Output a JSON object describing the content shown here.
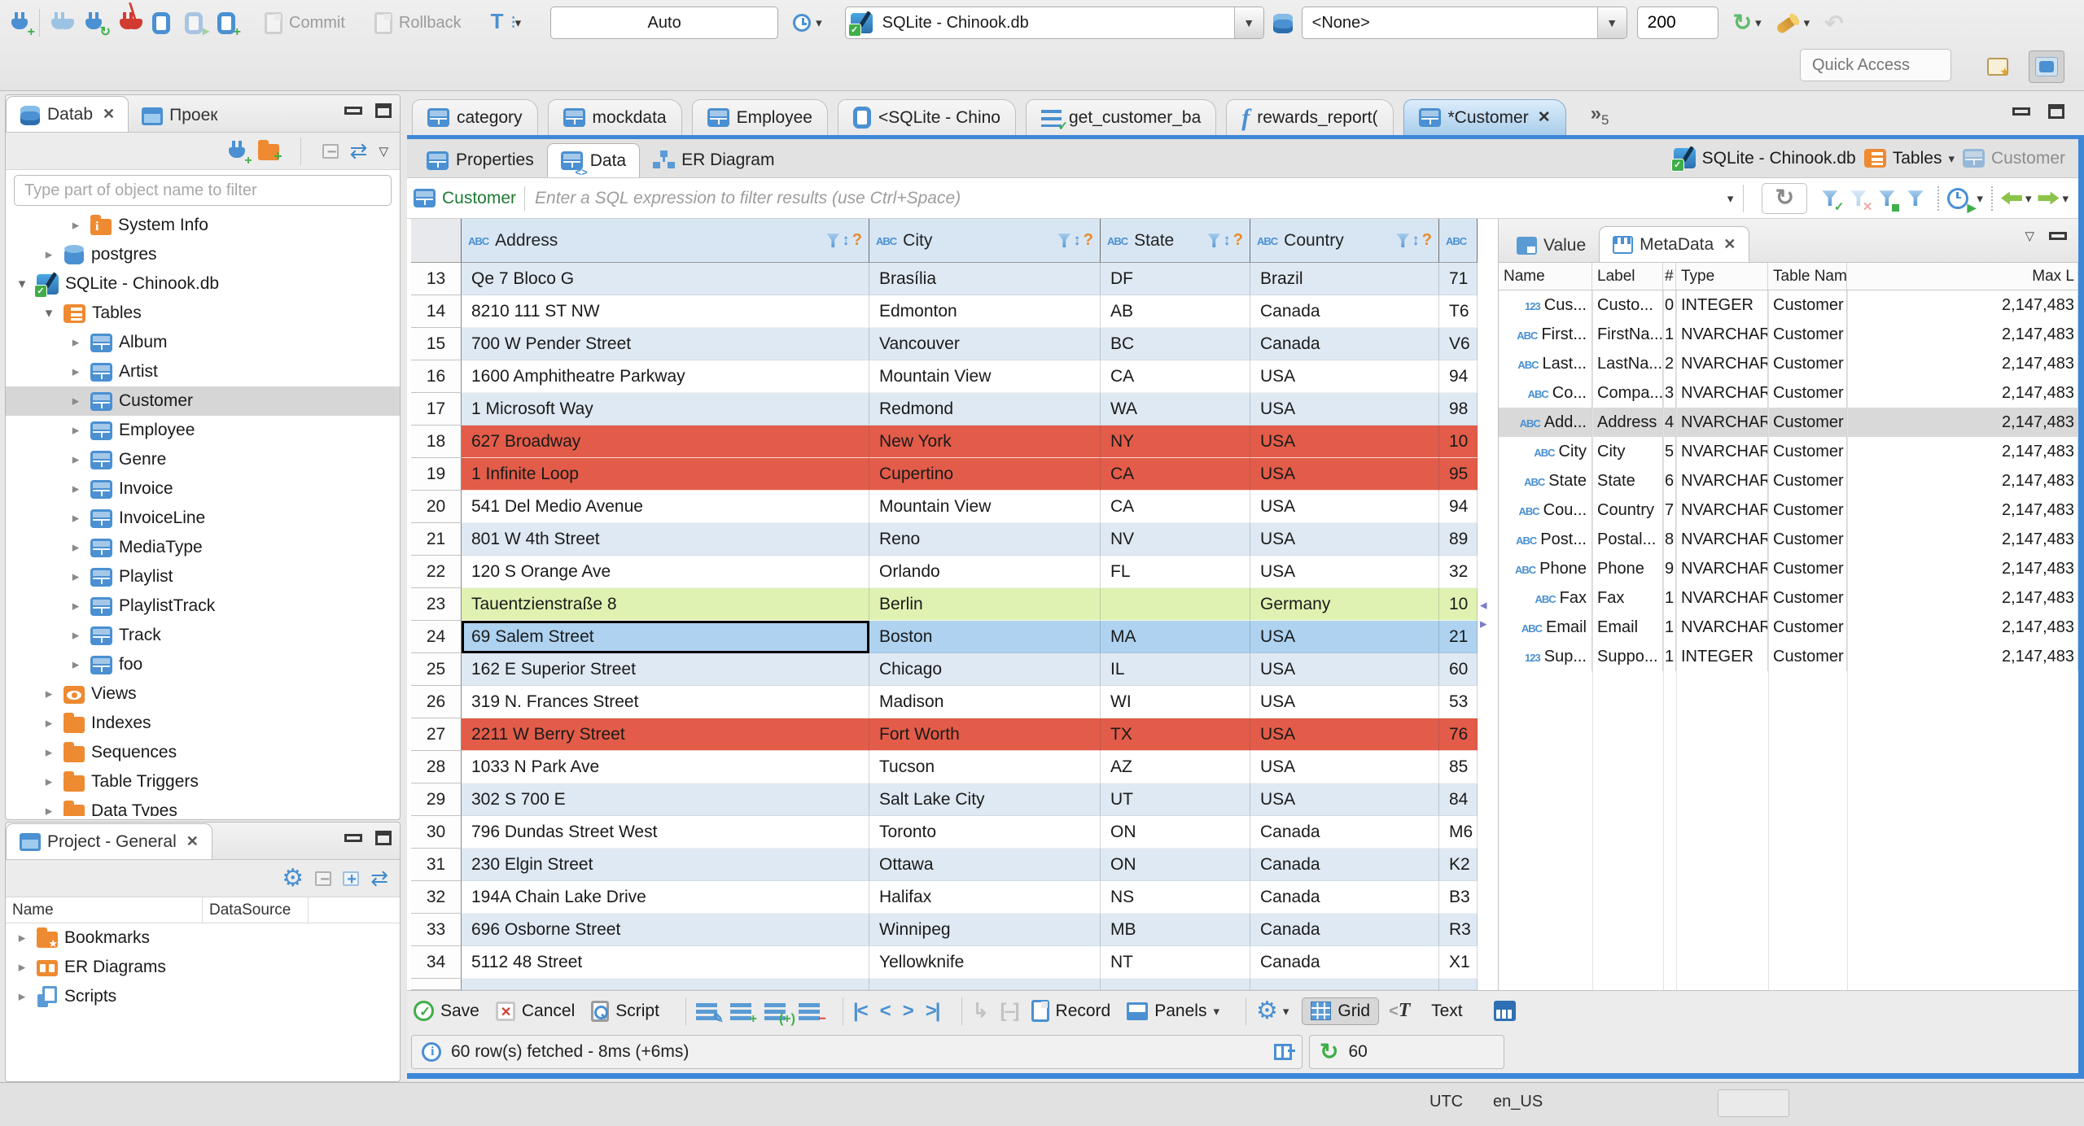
{
  "toolbar": {
    "auto": "Auto",
    "commit": "Commit",
    "rollback": "Rollback",
    "database": "SQLite - Chinook.db",
    "schema": "<None>",
    "row_limit": "200",
    "quick_access_placeholder": "Quick Access"
  },
  "sidebar": {
    "tab_database": "Datab",
    "tab_project": "Проек",
    "filter_placeholder": "Type part of object name to filter",
    "tree": [
      {
        "label": "System Info",
        "icon": "folder-info",
        "level": 3,
        "arrow": "right"
      },
      {
        "label": "postgres",
        "icon": "db",
        "level": 2,
        "arrow": "right"
      },
      {
        "label": "SQLite - Chinook.db",
        "icon": "sqlite",
        "level": 1,
        "arrow": "down"
      },
      {
        "label": "Tables",
        "icon": "table-folder",
        "level": 2,
        "arrow": "down"
      },
      {
        "label": "Album",
        "icon": "table",
        "level": 3,
        "arrow": "right"
      },
      {
        "label": "Artist",
        "icon": "table",
        "level": 3,
        "arrow": "right"
      },
      {
        "label": "Customer",
        "icon": "table",
        "level": 3,
        "arrow": "right",
        "selected": true
      },
      {
        "label": "Employee",
        "icon": "table",
        "level": 3,
        "arrow": "right"
      },
      {
        "label": "Genre",
        "icon": "table",
        "level": 3,
        "arrow": "right"
      },
      {
        "label": "Invoice",
        "icon": "table",
        "level": 3,
        "arrow": "right"
      },
      {
        "label": "InvoiceLine",
        "icon": "table",
        "level": 3,
        "arrow": "right"
      },
      {
        "label": "MediaType",
        "icon": "table",
        "level": 3,
        "arrow": "right"
      },
      {
        "label": "Playlist",
        "icon": "table",
        "level": 3,
        "arrow": "right"
      },
      {
        "label": "PlaylistTrack",
        "icon": "table",
        "level": 3,
        "arrow": "right"
      },
      {
        "label": "Track",
        "icon": "table",
        "level": 3,
        "arrow": "right"
      },
      {
        "label": "foo",
        "icon": "table",
        "level": 3,
        "arrow": "right"
      },
      {
        "label": "Views",
        "icon": "views",
        "level": 2,
        "arrow": "right"
      },
      {
        "label": "Indexes",
        "icon": "folder",
        "level": 2,
        "arrow": "right"
      },
      {
        "label": "Sequences",
        "icon": "folder",
        "level": 2,
        "arrow": "right"
      },
      {
        "label": "Table Triggers",
        "icon": "folder",
        "level": 2,
        "arrow": "right"
      },
      {
        "label": "Data Types",
        "icon": "folder",
        "level": 2,
        "arrow": "right",
        "clipped": true
      }
    ]
  },
  "project_panel": {
    "tab": "Project - General",
    "columns": [
      "Name",
      "DataSource"
    ],
    "items": [
      {
        "label": "Bookmarks",
        "icon": "folder-star"
      },
      {
        "label": "ER Diagrams",
        "icon": "erd-folder"
      },
      {
        "label": "Scripts",
        "icon": "scripts"
      }
    ]
  },
  "editor_tabs": {
    "tabs": [
      {
        "label": "category",
        "icon": "table"
      },
      {
        "label": "mockdata",
        "icon": "table"
      },
      {
        "label": "Employee",
        "icon": "table"
      },
      {
        "label": "<SQLite - Chino",
        "icon": "sqled"
      },
      {
        "label": "get_customer_ba",
        "icon": "sqllines"
      },
      {
        "label": "rewards_report(",
        "icon": "fx"
      },
      {
        "label": "*Customer",
        "icon": "table",
        "active": true,
        "closable": true
      }
    ],
    "overflow_count": "5"
  },
  "result_tabs": {
    "properties": "Properties",
    "data": "Data",
    "er_diagram": "ER Diagram"
  },
  "breadcrumb": {
    "database": "SQLite - Chinook.db",
    "container": "Tables",
    "entity": "Customer"
  },
  "filter_bar": {
    "entity": "Customer",
    "placeholder": "Enter a SQL expression to filter results (use Ctrl+Space)"
  },
  "grid": {
    "columns": [
      "Address",
      "City",
      "State",
      "Country"
    ],
    "rows": [
      {
        "num": "13",
        "address": "Qe 7 Bloco G",
        "city": "Brasília",
        "state": "DF",
        "country": "Brazil",
        "extra": "71",
        "style": "stripe"
      },
      {
        "num": "14",
        "address": "8210 111 ST NW",
        "city": "Edmonton",
        "state": "AB",
        "country": "Canada",
        "extra": "T6",
        "style": "white"
      },
      {
        "num": "15",
        "address": "700 W Pender Street",
        "city": "Vancouver",
        "state": "BC",
        "country": "Canada",
        "extra": "V6",
        "style": "stripe"
      },
      {
        "num": "16",
        "address": "1600 Amphitheatre Parkway",
        "city": "Mountain View",
        "state": "CA",
        "country": "USA",
        "extra": "94",
        "style": "white"
      },
      {
        "num": "17",
        "address": "1 Microsoft Way",
        "city": "Redmond",
        "state": "WA",
        "country": "USA",
        "extra": "98",
        "style": "stripe"
      },
      {
        "num": "18",
        "address": "627 Broadway",
        "city": "New York",
        "state": "NY",
        "country": "USA",
        "extra": "10",
        "style": "red"
      },
      {
        "num": "19",
        "address": "1 Infinite Loop",
        "city": "Cupertino",
        "state": "CA",
        "country": "USA",
        "extra": "95",
        "style": "red"
      },
      {
        "num": "20",
        "address": "541 Del Medio Avenue",
        "city": "Mountain View",
        "state": "CA",
        "country": "USA",
        "extra": "94",
        "style": "white"
      },
      {
        "num": "21",
        "address": "801 W 4th Street",
        "city": "Reno",
        "state": "NV",
        "country": "USA",
        "extra": "89",
        "style": "stripe"
      },
      {
        "num": "22",
        "address": "120 S Orange Ave",
        "city": "Orlando",
        "state": "FL",
        "country": "USA",
        "extra": "32",
        "style": "white"
      },
      {
        "num": "23",
        "address": "Tauentzienstraße 8",
        "city": "Berlin",
        "state": "",
        "country": "Germany",
        "extra": "10",
        "style": "green"
      },
      {
        "num": "24",
        "address": "69 Salem Street",
        "city": "Boston",
        "state": "MA",
        "country": "USA",
        "extra": "21",
        "style": "selected",
        "focused_cell": "address"
      },
      {
        "num": "25",
        "address": "162 E Superior Street",
        "city": "Chicago",
        "state": "IL",
        "country": "USA",
        "extra": "60",
        "style": "stripe"
      },
      {
        "num": "26",
        "address": "319 N. Frances Street",
        "city": "Madison",
        "state": "WI",
        "country": "USA",
        "extra": "53",
        "style": "white"
      },
      {
        "num": "27",
        "address": "2211 W Berry Street",
        "city": "Fort Worth",
        "state": "TX",
        "country": "USA",
        "extra": "76",
        "style": "red"
      },
      {
        "num": "28",
        "address": "1033 N Park Ave",
        "city": "Tucson",
        "state": "AZ",
        "country": "USA",
        "extra": "85",
        "style": "white"
      },
      {
        "num": "29",
        "address": "302 S 700 E",
        "city": "Salt Lake City",
        "state": "UT",
        "country": "USA",
        "extra": "84",
        "style": "stripe"
      },
      {
        "num": "30",
        "address": "796 Dundas Street West",
        "city": "Toronto",
        "state": "ON",
        "country": "Canada",
        "extra": "M6",
        "style": "white"
      },
      {
        "num": "31",
        "address": "230 Elgin Street",
        "city": "Ottawa",
        "state": "ON",
        "country": "Canada",
        "extra": "K2",
        "style": "stripe"
      },
      {
        "num": "32",
        "address": "194A Chain Lake Drive",
        "city": "Halifax",
        "state": "NS",
        "country": "Canada",
        "extra": "B3",
        "style": "white"
      },
      {
        "num": "33",
        "address": "696 Osborne Street",
        "city": "Winnipeg",
        "state": "MB",
        "country": "Canada",
        "extra": "R3",
        "style": "stripe"
      },
      {
        "num": "34",
        "address": "5112 48 Street",
        "city": "Yellowknife",
        "state": "NT",
        "country": "Canada",
        "extra": "X1",
        "style": "white"
      }
    ]
  },
  "metadata_panel": {
    "tab_value": "Value",
    "tab_metadata": "MetaData",
    "columns": [
      "Name",
      "Label",
      "#",
      "Type",
      "Table Name",
      "Max L"
    ],
    "rows": [
      {
        "icon": "123",
        "name": "Cus...",
        "label": "Custo...",
        "num": "0",
        "type": "INTEGER",
        "table": "Customer",
        "max_length": "2,147,483"
      },
      {
        "icon": "abc",
        "name": "First...",
        "label": "FirstNa...",
        "num": "1",
        "type": "NVARCHAR",
        "table": "Customer",
        "max_length": "2,147,483"
      },
      {
        "icon": "abc",
        "name": "Last...",
        "label": "LastNa...",
        "num": "2",
        "type": "NVARCHAR",
        "table": "Customer",
        "max_length": "2,147,483"
      },
      {
        "icon": "abc",
        "name": "Co...",
        "label": "Compa...",
        "num": "3",
        "type": "NVARCHAR",
        "table": "Customer",
        "max_length": "2,147,483"
      },
      {
        "icon": "abc",
        "name": "Add...",
        "label": "Address",
        "num": "4",
        "type": "NVARCHAR",
        "table": "Customer",
        "max_length": "2,147,483",
        "selected": true
      },
      {
        "icon": "abc",
        "name": "City",
        "label": "City",
        "num": "5",
        "type": "NVARCHAR",
        "table": "Customer",
        "max_length": "2,147,483"
      },
      {
        "icon": "abc",
        "name": "State",
        "label": "State",
        "num": "6",
        "type": "NVARCHAR",
        "table": "Customer",
        "max_length": "2,147,483"
      },
      {
        "icon": "abc",
        "name": "Cou...",
        "label": "Country",
        "num": "7",
        "type": "NVARCHAR",
        "table": "Customer",
        "max_length": "2,147,483"
      },
      {
        "icon": "abc",
        "name": "Post...",
        "label": "Postal...",
        "num": "8",
        "type": "NVARCHAR",
        "table": "Customer",
        "max_length": "2,147,483"
      },
      {
        "icon": "abc",
        "name": "Phone",
        "label": "Phone",
        "num": "9",
        "type": "NVARCHAR",
        "table": "Customer",
        "max_length": "2,147,483"
      },
      {
        "icon": "abc",
        "name": "Fax",
        "label": "Fax",
        "num": "1",
        "type": "NVARCHAR",
        "table": "Customer",
        "max_length": "2,147,483"
      },
      {
        "icon": "abc",
        "name": "Email",
        "label": "Email",
        "num": "1",
        "type": "NVARCHAR",
        "table": "Customer",
        "max_length": "2,147,483"
      },
      {
        "icon": "123",
        "name": "Sup...",
        "label": "Suppo...",
        "num": "1",
        "type": "INTEGER",
        "table": "Customer",
        "max_length": "2,147,483"
      }
    ]
  },
  "bottom_toolbar": {
    "save": "Save",
    "cancel": "Cancel",
    "script": "Script",
    "record": "Record",
    "panels": "Panels",
    "grid": "Grid",
    "text": "Text"
  },
  "status_row": {
    "message": "60 row(s) fetched - 8ms (+6ms)",
    "refresh_count": "60"
  },
  "status_bar": {
    "timezone": "UTC",
    "locale": "en_US"
  },
  "colors": {
    "accent_blue": "#3d87d8",
    "row_red": "#e25c49",
    "row_green": "#e0f2b2",
    "row_selected": "#aed2f0",
    "row_stripe": "#dfe9f3",
    "header_blue": "#d8e6f4",
    "icon_blue": "#4a90d2",
    "icon_orange": "#ee8a31"
  }
}
